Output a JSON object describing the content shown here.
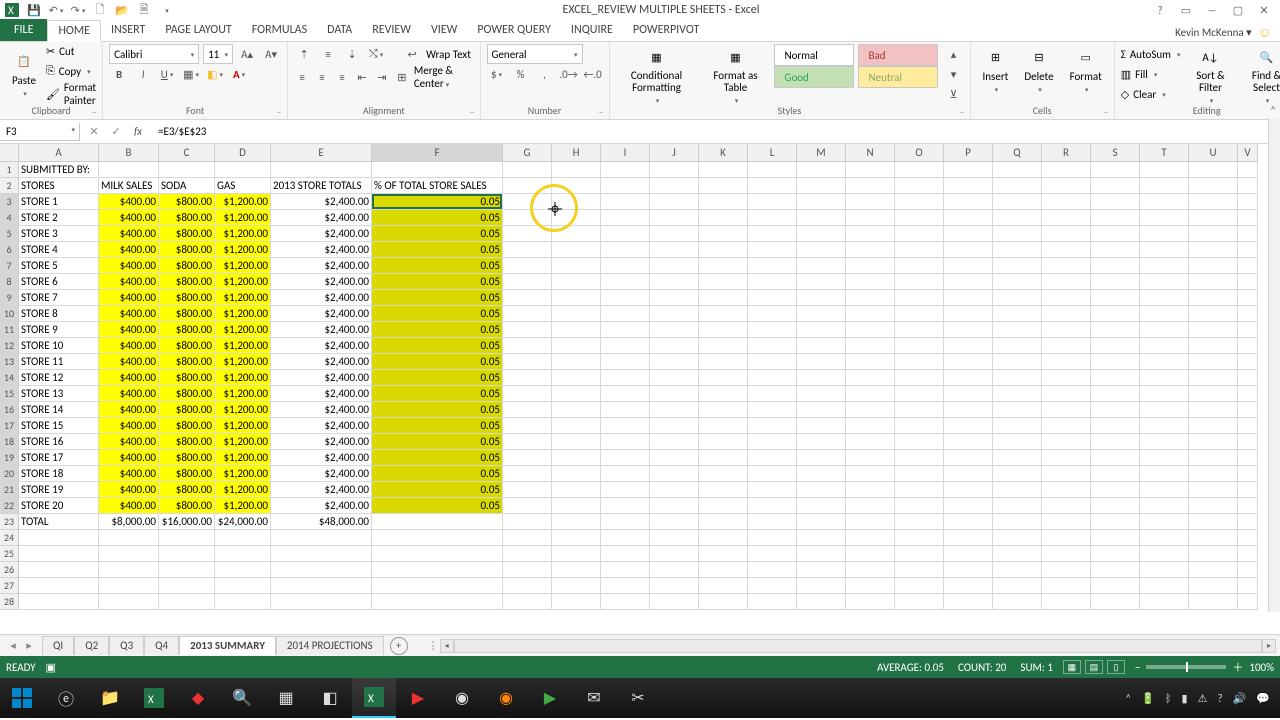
{
  "window": {
    "title": "EXCEL_REVIEW MULTIPLE SHEETS - Excel"
  },
  "account": {
    "name": "Kevin McKenna"
  },
  "ribbon": {
    "tabs": [
      "FILE",
      "HOME",
      "INSERT",
      "PAGE LAYOUT",
      "FORMULAS",
      "DATA",
      "REVIEW",
      "VIEW",
      "POWER QUERY",
      "INQUIRE",
      "POWERPIVOT"
    ],
    "active": "HOME",
    "clipboard": {
      "cut": "Cut",
      "copy": "Copy",
      "format_painter": "Format Painter",
      "paste": "Paste",
      "group": "Clipboard"
    },
    "font": {
      "name": "Calibri",
      "size": "11",
      "group": "Font"
    },
    "alignment": {
      "wrap": "Wrap Text",
      "merge": "Merge & Center",
      "group": "Alignment"
    },
    "number": {
      "format": "General",
      "group": "Number"
    },
    "styles": {
      "cond": "Conditional Formatting",
      "fmt_table": "Format as Table",
      "normal": "Normal",
      "bad": "Bad",
      "good": "Good",
      "neutral": "Neutral",
      "group": "Styles"
    },
    "cells": {
      "insert": "Insert",
      "delete": "Delete",
      "format": "Format",
      "group": "Cells"
    },
    "editing": {
      "autosum": "AutoSum",
      "fill": "Fill",
      "clear": "Clear",
      "sort": "Sort & Filter",
      "find": "Find & Select",
      "group": "Editing"
    }
  },
  "namebox": "F3",
  "formula": "=E3/$E$23",
  "columns": [
    "A",
    "B",
    "C",
    "D",
    "E",
    "F",
    "G",
    "H",
    "I",
    "J",
    "K",
    "L",
    "M",
    "N",
    "O",
    "P",
    "Q",
    "R",
    "S",
    "T",
    "U",
    "V"
  ],
  "headers": {
    "a1": "SUBMITTED BY:",
    "a2": "STORES",
    "b2": "MILK SALES",
    "c2": "SODA",
    "d2": "GAS",
    "e2": "2013 STORE TOTALS",
    "f2": "% OF TOTAL STORE SALES"
  },
  "rows": [
    {
      "n": 3,
      "store": "STORE 1",
      "milk": "$400.00",
      "soda": "$800.00",
      "gas": "$1,200.00",
      "tot": "$2,400.00",
      "pct": "0.05"
    },
    {
      "n": 4,
      "store": "STORE 2",
      "milk": "$400.00",
      "soda": "$800.00",
      "gas": "$1,200.00",
      "tot": "$2,400.00",
      "pct": "0.05"
    },
    {
      "n": 5,
      "store": "STORE 3",
      "milk": "$400.00",
      "soda": "$800.00",
      "gas": "$1,200.00",
      "tot": "$2,400.00",
      "pct": "0.05"
    },
    {
      "n": 6,
      "store": "STORE 4",
      "milk": "$400.00",
      "soda": "$800.00",
      "gas": "$1,200.00",
      "tot": "$2,400.00",
      "pct": "0.05"
    },
    {
      "n": 7,
      "store": "STORE 5",
      "milk": "$400.00",
      "soda": "$800.00",
      "gas": "$1,200.00",
      "tot": "$2,400.00",
      "pct": "0.05"
    },
    {
      "n": 8,
      "store": "STORE 6",
      "milk": "$400.00",
      "soda": "$800.00",
      "gas": "$1,200.00",
      "tot": "$2,400.00",
      "pct": "0.05"
    },
    {
      "n": 9,
      "store": "STORE 7",
      "milk": "$400.00",
      "soda": "$800.00",
      "gas": "$1,200.00",
      "tot": "$2,400.00",
      "pct": "0.05"
    },
    {
      "n": 10,
      "store": "STORE 8",
      "milk": "$400.00",
      "soda": "$800.00",
      "gas": "$1,200.00",
      "tot": "$2,400.00",
      "pct": "0.05"
    },
    {
      "n": 11,
      "store": "STORE 9",
      "milk": "$400.00",
      "soda": "$800.00",
      "gas": "$1,200.00",
      "tot": "$2,400.00",
      "pct": "0.05"
    },
    {
      "n": 12,
      "store": "STORE 10",
      "milk": "$400.00",
      "soda": "$800.00",
      "gas": "$1,200.00",
      "tot": "$2,400.00",
      "pct": "0.05"
    },
    {
      "n": 13,
      "store": "STORE 11",
      "milk": "$400.00",
      "soda": "$800.00",
      "gas": "$1,200.00",
      "tot": "$2,400.00",
      "pct": "0.05"
    },
    {
      "n": 14,
      "store": "STORE 12",
      "milk": "$400.00",
      "soda": "$800.00",
      "gas": "$1,200.00",
      "tot": "$2,400.00",
      "pct": "0.05"
    },
    {
      "n": 15,
      "store": "STORE 13",
      "milk": "$400.00",
      "soda": "$800.00",
      "gas": "$1,200.00",
      "tot": "$2,400.00",
      "pct": "0.05"
    },
    {
      "n": 16,
      "store": "STORE 14",
      "milk": "$400.00",
      "soda": "$800.00",
      "gas": "$1,200.00",
      "tot": "$2,400.00",
      "pct": "0.05"
    },
    {
      "n": 17,
      "store": "STORE 15",
      "milk": "$400.00",
      "soda": "$800.00",
      "gas": "$1,200.00",
      "tot": "$2,400.00",
      "pct": "0.05"
    },
    {
      "n": 18,
      "store": "STORE 16",
      "milk": "$400.00",
      "soda": "$800.00",
      "gas": "$1,200.00",
      "tot": "$2,400.00",
      "pct": "0.05"
    },
    {
      "n": 19,
      "store": "STORE 17",
      "milk": "$400.00",
      "soda": "$800.00",
      "gas": "$1,200.00",
      "tot": "$2,400.00",
      "pct": "0.05"
    },
    {
      "n": 20,
      "store": "STORE 18",
      "milk": "$400.00",
      "soda": "$800.00",
      "gas": "$1,200.00",
      "tot": "$2,400.00",
      "pct": "0.05"
    },
    {
      "n": 21,
      "store": "STORE 19",
      "milk": "$400.00",
      "soda": "$800.00",
      "gas": "$1,200.00",
      "tot": "$2,400.00",
      "pct": "0.05"
    },
    {
      "n": 22,
      "store": "STORE 20",
      "milk": "$400.00",
      "soda": "$800.00",
      "gas": "$1,200.00",
      "tot": "$2,400.00",
      "pct": "0.05"
    }
  ],
  "total_row": {
    "n": 23,
    "label": "TOTAL",
    "milk": "$8,000.00",
    "soda": "$16,000.00",
    "gas": "$24,000.00",
    "tot": "$48,000.00"
  },
  "empty_rows": [
    24,
    25,
    26,
    27,
    28
  ],
  "sheets": {
    "tabs": [
      "QI",
      "Q2",
      "Q3",
      "Q4",
      "2013 SUMMARY",
      "2014 PROJECTIONS"
    ],
    "active": "2013 SUMMARY"
  },
  "status": {
    "ready": "READY",
    "average": "AVERAGE: 0.05",
    "count": "COUNT: 20",
    "sum": "SUM: 1",
    "zoom": "100%"
  },
  "taskbar": {
    "time": "",
    "icons": []
  }
}
